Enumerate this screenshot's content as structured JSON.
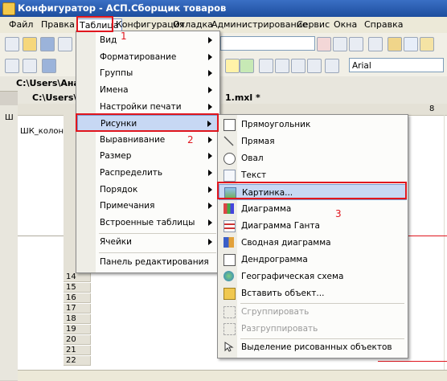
{
  "window": {
    "title": "Конфигуратор - АСП.Сборщик товаров"
  },
  "menubar": [
    "Файл",
    "Правка",
    "Таблица",
    "Конфигурация",
    "Отладка",
    "Администрирование",
    "Сервис",
    "Окна",
    "Справка"
  ],
  "toolbar": {
    "font_name": "Arial"
  },
  "documents": {
    "outer_path": "C:\\Users\\Ана",
    "inner_path": "C:\\Users\\",
    "inner_suffix": "1.mxl *"
  },
  "sheet": {
    "cell_text": "ШК_колонки",
    "left_marker": "Ш",
    "col_header_8": "8",
    "row_numbers": [
      "14",
      "15",
      "16",
      "17",
      "18",
      "19",
      "20",
      "21",
      "22"
    ]
  },
  "table_menu": {
    "items": [
      "Вид",
      "Форматирование",
      "Группы",
      "Имена",
      "Настройки печати",
      "Рисунки",
      "Выравнивание",
      "Размер",
      "Распределить",
      "Порядок",
      "Примечания",
      "Встроенные таблицы",
      "Ячейки",
      "Панель редактирования"
    ]
  },
  "pictures_menu": {
    "items": [
      "Прямоугольник",
      "Прямая",
      "Овал",
      "Текст",
      "Картинка...",
      "Диаграмма",
      "Диаграмма Ганта",
      "Сводная диаграмма",
      "Дендрограмма",
      "Географическая схема",
      "Вставить объект...",
      "Сгруппировать",
      "Разгруппировать",
      "Выделение рисованных объектов"
    ]
  },
  "annotations": {
    "n1": "1",
    "n2": "2",
    "n3": "3"
  },
  "colors": {
    "highlight": "#c7d8f4",
    "annotation_red": "#e0161e",
    "titlebar": "#1d4e9e"
  }
}
